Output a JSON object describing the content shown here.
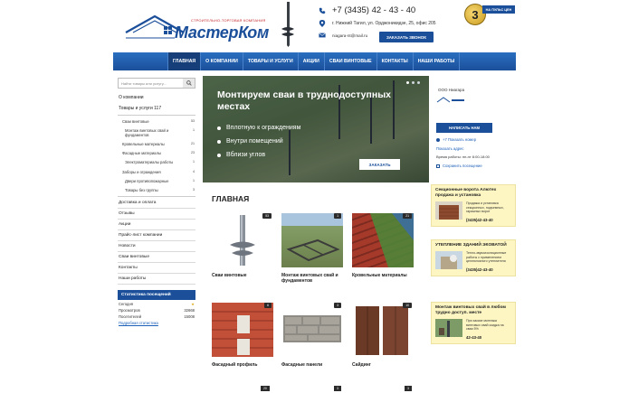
{
  "header": {
    "logo_slogan": "СТРОИТЕЛЬНО-ТОРГОВАЯ КОМПАНИЯ",
    "logo_name": "МастерКом",
    "phone": "+7 (3435) 42 - 43 - 40",
    "address": "г. Нижний Тагил, ул. Орджоникидзе, 25, офис 205",
    "email": "niagara-nt@mail.ru",
    "call_button": "ЗАКАЗАТЬ ЗВОНОК",
    "badge_number": "3",
    "badge_ribbon": "НА ПУЛЬС ЦЕН"
  },
  "nav": {
    "items": [
      "ГЛАВНАЯ",
      "О КОМПАНИИ",
      "ТОВАРЫ И УСЛУГИ",
      "АКЦИИ",
      "СВАИ ВИНТОВЫЕ",
      "КОНТАКТЫ",
      "НАШИ РАБОТЫ"
    ]
  },
  "sidebar": {
    "search_placeholder": "Найти товары или услугу...",
    "about": "О компании",
    "goods": "Товары и услуги 117",
    "categories": [
      {
        "label": "Сваи винтовые",
        "count": "53"
      },
      {
        "label": "Монтаж винтовых свай и фундаментов",
        "count": "1"
      },
      {
        "label": "Кровельные материалы",
        "count": "21"
      },
      {
        "label": "Фасадные материалы",
        "count": "23"
      },
      {
        "label": "Электроматериалы работы",
        "count": "1"
      },
      {
        "label": "Заборы и ограждения",
        "count": "4"
      },
      {
        "label": "Двери противопожарные",
        "count": "1"
      },
      {
        "label": "Товары без группы",
        "count": "3"
      }
    ],
    "menu": [
      "Доставка и оплата",
      "Отзывы",
      "Акции",
      "Прайс-лист компании",
      "Новости",
      "Сваи винтовые",
      "Контакты",
      "Наши работы"
    ],
    "stats_title": "Статистика посещений",
    "stats": [
      {
        "label": "Сегодня",
        "value": ""
      },
      {
        "label": "Просмотров",
        "value": "32668"
      },
      {
        "label": "Посетителей",
        "value": "15008"
      }
    ],
    "stats_link": "Подробная статистика"
  },
  "slider": {
    "title": "Монтируем сваи в труднодоступных местах",
    "bullets": [
      "Вплотную к ограждениям",
      "Внутри помещений",
      "Вблизи углов"
    ],
    "button": "ЗАКАЗАТЬ"
  },
  "main": {
    "heading": "ГЛАВНАЯ",
    "products": [
      {
        "name": "Сваи винтовые",
        "count": "53"
      },
      {
        "name": "Монтаж винтовых свай и фундаментов",
        "count": "1"
      },
      {
        "name": "Кровельные материалы",
        "count": "21"
      },
      {
        "name": "Фасадный профиль",
        "count": "6"
      },
      {
        "name": "Фасадные панели",
        "count": "3"
      },
      {
        "name": "Сайдинг",
        "count": "10"
      }
    ],
    "bottom_counts": [
      "20",
      "3",
      "3"
    ]
  },
  "right": {
    "company": "ООО Ниагара",
    "write_button": "НАПИСАТЬ НАМ",
    "show_number": "+7 Показать номер",
    "show_address": "Показать адрес",
    "hours": "Время работы: пн-пт 8:00-18:00",
    "save_contacts": "Сохранить посещение",
    "ads": [
      {
        "title": "Секционные ворота Алютех продажа и установка",
        "text": "Продажа и установка секционных, подъемных, гаражных ворот",
        "phone": "(3435)42-43-40"
      },
      {
        "title": "УТЕПЛЕНИЕ ЗДАНИЙ ЭКОВАТОЙ",
        "text": "Тепло-звукоизоляционные работы с применением целлюлозного утеплителя",
        "phone": "(3435)42-43-40"
      },
      {
        "title": "Монтаж винтовых свай в любом трудно доступ. месте",
        "text": "При заказе монтажа винтовых свай скидка на сваи 5%",
        "phone": "42-43-40"
      }
    ]
  },
  "colors": {
    "brand_blue": "#1b4f9a",
    "accent_red": "#c5282a",
    "ad_bg": "#fdf6c3"
  }
}
